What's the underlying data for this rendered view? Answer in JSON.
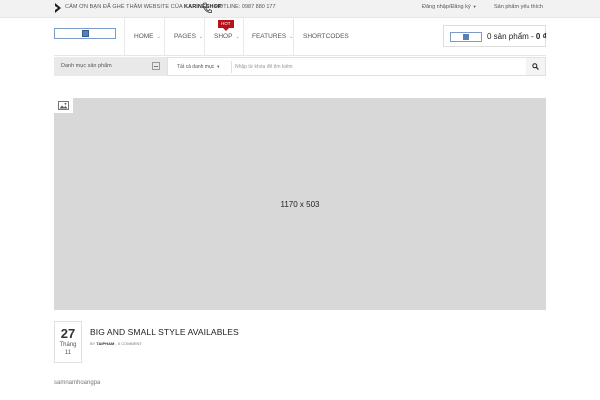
{
  "topbar": {
    "welcome_prefix": "CẢM ƠN BẠN ĐÃ GHÉ THĂM WEBSITE CỦA ",
    "welcome_brand": "KARINESHOP",
    "hotline": "HOTLINE: 0987 880 177",
    "login": "Đăng nhập/Đăng ký",
    "wishlist": "Sản phẩm yêu thích"
  },
  "nav": {
    "items": [
      "HOME",
      "PAGES",
      "SHOP",
      "FEATURES",
      "SHORTCODES"
    ],
    "hot_badge": "HOT"
  },
  "cart": {
    "count_text": "0 sản phẩm - ",
    "total": "0 ₫"
  },
  "search": {
    "category_button": "Danh mục sản phẩm",
    "category_select": "Tất cả danh mục",
    "placeholder": "Nhập từ khóa để tìm kiếm"
  },
  "hero": {
    "dimensions": "1170 x 503"
  },
  "post": {
    "day": "27",
    "month_label": "Tháng",
    "month_num": "11",
    "title": "BIG AND SMALL STYLE AVAILABLES",
    "by": "BY ",
    "author": "taipham",
    "comments": " - 0 comment"
  },
  "footer": {
    "text": "samnamhoangpa"
  },
  "colors": {
    "hot_badge": "#b5121b",
    "placeholder_bg": "#d8d8d8"
  }
}
